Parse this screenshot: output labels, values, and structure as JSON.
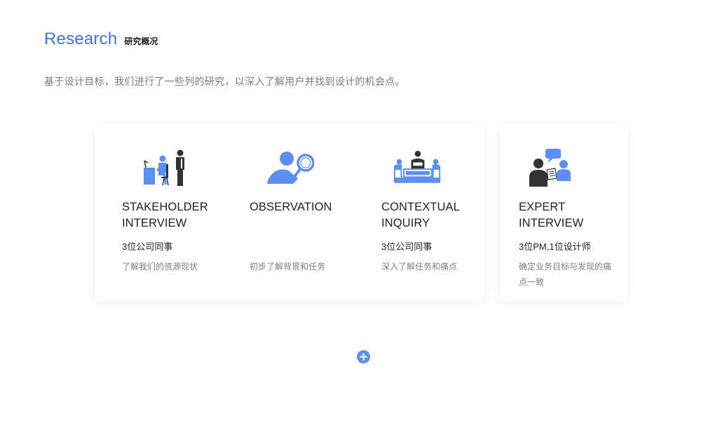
{
  "header": {
    "title": "Research",
    "subtitle": "研究概况"
  },
  "intro": "基于设计目标，我们进行了一些列的研究，以深入了解用户并找到设计的机会点。",
  "methods": [
    {
      "heading_line1": "STAKEHOLDER",
      "heading_line2": "INTERVIEW",
      "who": "3位公司同事",
      "desc": "了解我们的资源现状",
      "icon": "stakeholder-interview-icon"
    },
    {
      "heading_line1": "OBSERVATION",
      "heading_line2": "",
      "who": "",
      "desc": "初步了解背景和任务",
      "icon": "magnifier-observation-icon"
    },
    {
      "heading_line1": "CONTEXTUAL",
      "heading_line2": "INQUIRY",
      "who": "3位公司同事",
      "desc": "深入了解任务和痛点",
      "icon": "contextual-inquiry-icon"
    },
    {
      "heading_line1": "EXPERT",
      "heading_line2": "INTERVIEW",
      "who": "3位PM,1位设计师",
      "desc": "确定业务目标与发现的痛点一致",
      "icon": "expert-interview-icon"
    }
  ],
  "colors": {
    "accent": "#3a73f0",
    "icon_blue": "#5b8ff5",
    "icon_dark": "#333333"
  },
  "add_button": {
    "icon": "plus-icon"
  }
}
